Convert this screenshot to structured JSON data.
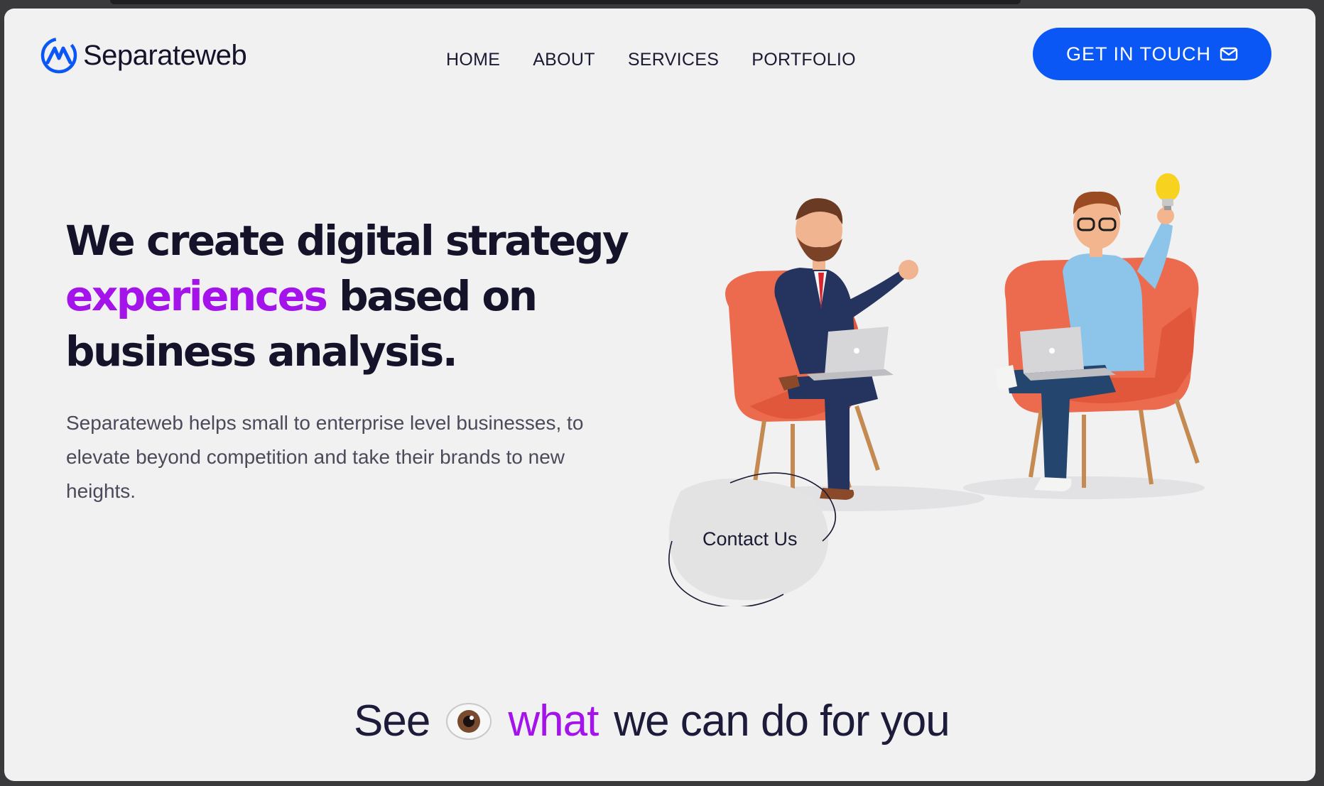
{
  "brand": {
    "name": "Separateweb",
    "accent": "#0a57f5"
  },
  "nav": {
    "items": [
      "HOME",
      "ABOUT",
      "SERVICES",
      "PORTFOLIO"
    ]
  },
  "cta": {
    "label": "GET IN TOUCH",
    "icon": "mail-icon"
  },
  "hero": {
    "line1": "We create digital strategy",
    "accent_word": "experiences",
    "line2_rest": "based on",
    "line3": "business analysis.",
    "accent_color": "#a413ea",
    "description": "Separateweb helps small to enterprise level businesses, to elevate beyond competition and take their brands to new heights.",
    "contact_label": "Contact Us",
    "illustration": "two-people-in-armchairs-with-laptops-illustration"
  },
  "section": {
    "see": "See",
    "icon": "eye-icon",
    "what": "what",
    "rest": "we can do for you"
  }
}
